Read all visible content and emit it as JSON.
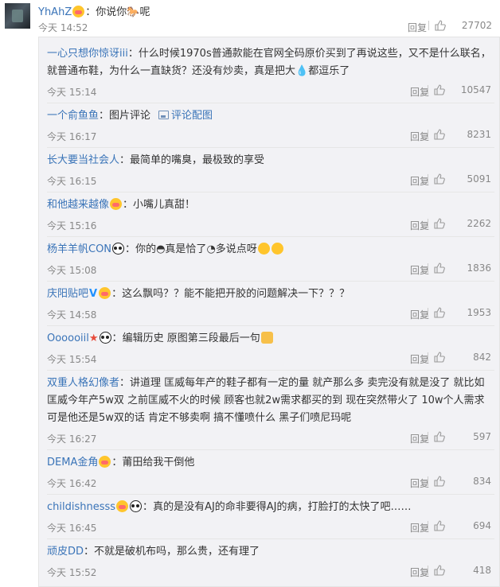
{
  "top_comment": {
    "user": "YhAhZ",
    "text": "你说你",
    "text_tail": "呢",
    "time": "今天 14:52",
    "reply_label": "回复",
    "likes": "27702"
  },
  "replies": [
    {
      "user": "一心只想你惊讶iii",
      "text": "什么时候1970s普通款能在官网全码原价买到了再说这些，又不是什么联名，就普通布鞋，为什么一直缺货？还没有炒卖，真是把大",
      "text_tail": "都逗乐了",
      "time": "今天 15:14",
      "reply_label": "回复",
      "likes": "10547"
    },
    {
      "user": "一个俞鱼鱼",
      "text": "图片评论",
      "pic_label": "评论配图",
      "time": "今天 16:17",
      "reply_label": "回复",
      "likes": "8231"
    },
    {
      "user": "长大要当社会人",
      "text": "最简单的嘴臭，最极致的享受",
      "time": "今天 16:15",
      "reply_label": "回复",
      "likes": "5091"
    },
    {
      "user": "和他越来越像",
      "text": "小嘴儿真甜！",
      "time": "今天 15:16",
      "reply_label": "回复",
      "likes": "2262"
    },
    {
      "user": "杨羊羊帆CON",
      "text": "你的",
      "text_mid": "真是恰了",
      "text_tail": "多说点呀",
      "time": "今天 15:08",
      "reply_label": "回复",
      "likes": "1836"
    },
    {
      "user": "庆阳贴吧",
      "text": "这么飘吗？？能不能把开胶的问题解决一下？？？",
      "time": "今天 14:58",
      "reply_label": "回复",
      "likes": "1953"
    },
    {
      "user": "Oooooiil",
      "text": "编辑历史 原图第三段最后一句",
      "time": "今天 15:54",
      "reply_label": "回复",
      "likes": "842"
    },
    {
      "user": "双重人格幻像者",
      "text": "讲道理 匡威每年产的鞋子都有一定的量 就产那么多 卖完没有就是没了  就比如匡威今年产5w双 之前匡威不火的时候 顾客也就2w需求都买的到 现在突然带火了 10w个人需求 可是他还是5w双的话 肯定不够卖啊 搞不懂喷什么 黑子们喷尼玛呢",
      "time": "今天 16:27",
      "reply_label": "回复",
      "likes": "597"
    },
    {
      "user": "DEMA金角",
      "text": "莆田给我干倒他",
      "time": "今天 16:42",
      "reply_label": "回复",
      "likes": "834"
    },
    {
      "user": "childishnesss",
      "text": "真的是没有AJ的命非要得AJ的病，打脸打的太快了吧……",
      "time": "今天 16:45",
      "reply_label": "回复",
      "likes": "694"
    },
    {
      "user": "顽皮DD",
      "text": "不就是破机布吗，那么贵，还有理了",
      "time": "今天 15:52",
      "reply_label": "回复",
      "likes": "418"
    }
  ],
  "colors": {
    "username": "#3a74b8",
    "meta": "#888888",
    "panel": "#f2f2f5"
  }
}
